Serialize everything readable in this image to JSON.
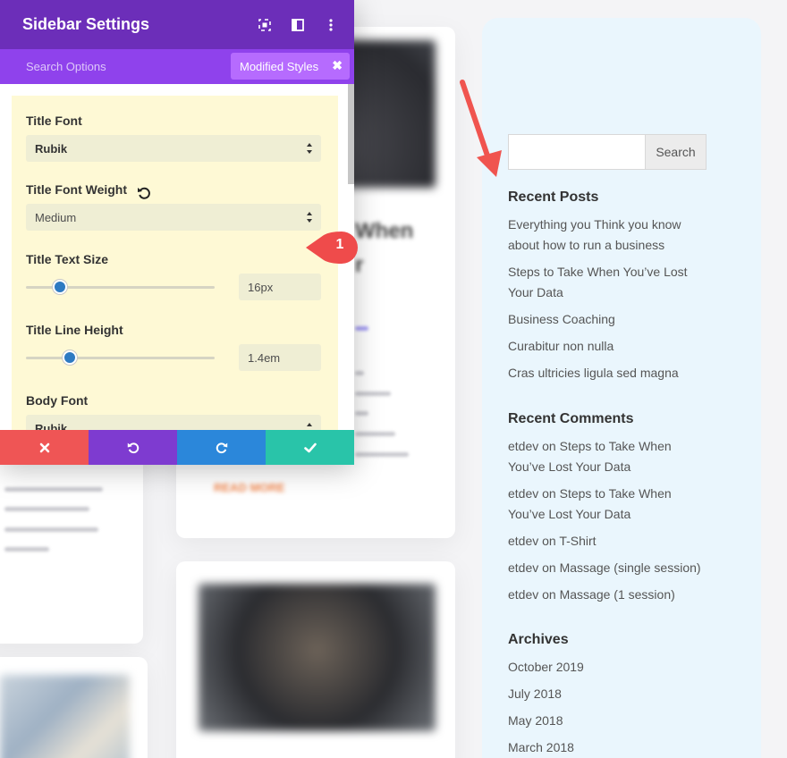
{
  "modal": {
    "title": "Sidebar Settings",
    "search_placeholder": "Search Options",
    "filter_chip": "Modified Styles",
    "header_icons": [
      "expand-icon",
      "columns-layout-icon",
      "more-vertical-icon"
    ],
    "options": {
      "title_font": {
        "label": "Title Font",
        "value": "Rubik"
      },
      "title_font_weight": {
        "label": "Title Font Weight",
        "value": "Medium"
      },
      "title_text_size": {
        "label": "Title Text Size",
        "value": "16px",
        "level": 0.18
      },
      "title_line_height": {
        "label": "Title Line Height",
        "value": "1.4em",
        "level": 0.23
      },
      "body_font": {
        "label": "Body Font",
        "value": "Rubik"
      }
    },
    "footer": {
      "cancel_color": "#ef5555",
      "undo_color": "#7e3bd0",
      "redo_color": "#2b87da",
      "save_color": "#29c4a9"
    }
  },
  "callout": {
    "number": "1",
    "color": "#ef4b4b"
  },
  "sidebar": {
    "search": {
      "button": "Search",
      "placeholder": ""
    },
    "recent_posts": {
      "title": "Recent Posts",
      "items": [
        "Everything you Think you know about how to run a business",
        "Steps to Take When You’ve Lost Your Data",
        "Business Coaching",
        "Curabitur non nulla",
        "Cras ultricies ligula sed magna"
      ]
    },
    "recent_comments": {
      "title": "Recent Comments",
      "items": [
        "etdev on Steps to Take When You’ve Lost Your Data",
        "etdev on Steps to Take When You’ve Lost Your Data",
        "etdev on T-Shirt",
        "etdev on Massage (single session)",
        "etdev on Massage (1 session)"
      ]
    },
    "archives": {
      "title": "Archives",
      "items": [
        "October 2019",
        "July 2018",
        "May 2018",
        "March 2018"
      ]
    }
  },
  "background": {
    "post_title_fragments": [
      "When",
      "r"
    ],
    "read_more": "READ MORE"
  },
  "colors": {
    "modal_header": "#6c2eb9",
    "modal_subbar": "#8f42ec",
    "chip": "#b66bfe",
    "panel": "#fef9d5",
    "slider": "#2e7ac2",
    "sidebar_bg": "#eaf6fd",
    "read_more": "#f28a52"
  }
}
